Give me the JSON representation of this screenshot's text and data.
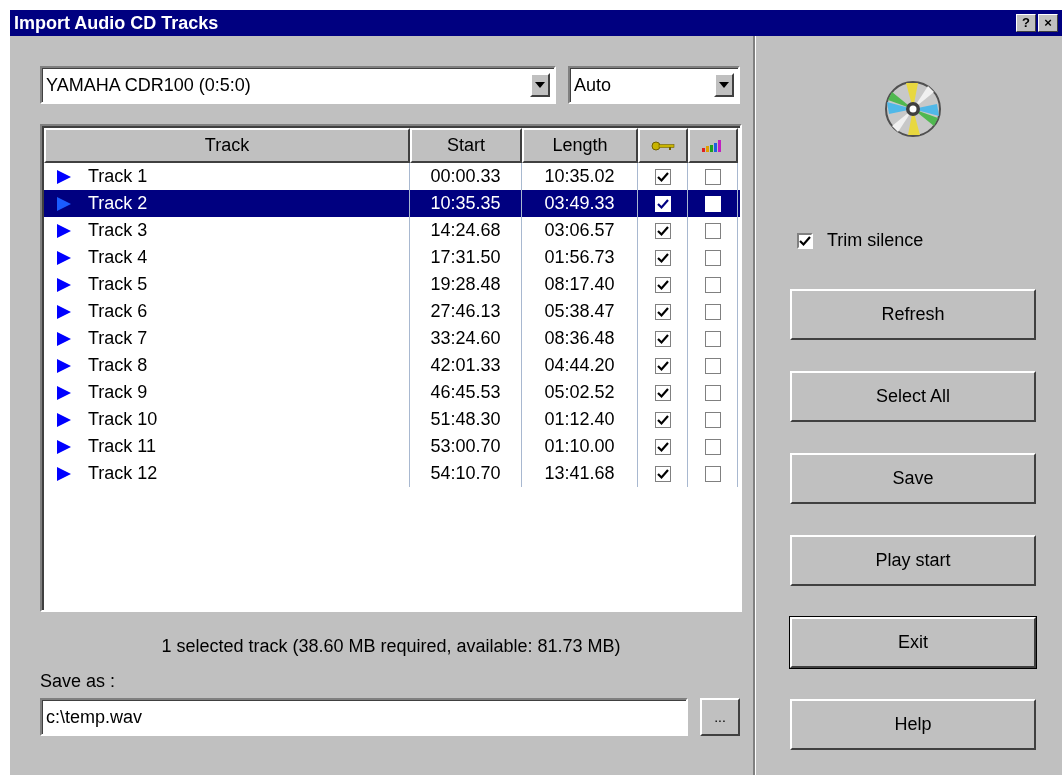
{
  "window": {
    "title": "Import Audio CD Tracks",
    "title_buttons": [
      "?",
      "×"
    ]
  },
  "drive": {
    "value": "YAMAHA CDR100 (0:5:0)"
  },
  "speed": {
    "value": "Auto"
  },
  "table": {
    "columns": [
      "Track",
      "Start",
      "Length"
    ],
    "rows": [
      {
        "name": "Track 1",
        "start": "00:00.33",
        "length": "10:35.02",
        "column_4_checked": true,
        "column_5_checked": false,
        "selected": false
      },
      {
        "name": "Track 2",
        "start": "10:35.35",
        "length": "03:49.33",
        "column_4_checked": true,
        "column_5_checked": false,
        "selected": true
      },
      {
        "name": "Track 3",
        "start": "14:24.68",
        "length": "03:06.57",
        "column_4_checked": true,
        "column_5_checked": false,
        "selected": false
      },
      {
        "name": "Track 4",
        "start": "17:31.50",
        "length": "01:56.73",
        "column_4_checked": true,
        "column_5_checked": false,
        "selected": false
      },
      {
        "name": "Track 5",
        "start": "19:28.48",
        "length": "08:17.40",
        "column_4_checked": true,
        "column_5_checked": false,
        "selected": false
      },
      {
        "name": "Track 6",
        "start": "27:46.13",
        "length": "05:38.47",
        "column_4_checked": true,
        "column_5_checked": false,
        "selected": false
      },
      {
        "name": "Track 7",
        "start": "33:24.60",
        "length": "08:36.48",
        "column_4_checked": true,
        "column_5_checked": false,
        "selected": false
      },
      {
        "name": "Track 8",
        "start": "42:01.33",
        "length": "04:44.20",
        "column_4_checked": true,
        "column_5_checked": false,
        "selected": false
      },
      {
        "name": "Track 9",
        "start": "46:45.53",
        "length": "05:02.52",
        "column_4_checked": true,
        "column_5_checked": false,
        "selected": false
      },
      {
        "name": "Track 10",
        "start": "51:48.30",
        "length": "01:12.40",
        "column_4_checked": true,
        "column_5_checked": false,
        "selected": false
      },
      {
        "name": "Track 11",
        "start": "53:00.70",
        "length": "01:10.00",
        "column_4_checked": true,
        "column_5_checked": false,
        "selected": false
      },
      {
        "name": "Track 12",
        "start": "54:10.70",
        "length": "13:41.68",
        "column_4_checked": true,
        "column_5_checked": false,
        "selected": false
      }
    ]
  },
  "status": "1 selected track (38.60 MB required, available: 81.73 MB)",
  "save_as": {
    "label": "Save as :",
    "value": "c:\\temp.wav",
    "browse": "..."
  },
  "trim_silence": {
    "label": "Trim silence",
    "checked": true
  },
  "buttons": [
    {
      "label": "Refresh",
      "default": false
    },
    {
      "label": "Select All",
      "default": false
    },
    {
      "label": "Save",
      "default": false
    },
    {
      "label": "Play start",
      "default": false
    },
    {
      "label": "Exit",
      "default": true
    },
    {
      "label": "Help",
      "default": false
    }
  ]
}
